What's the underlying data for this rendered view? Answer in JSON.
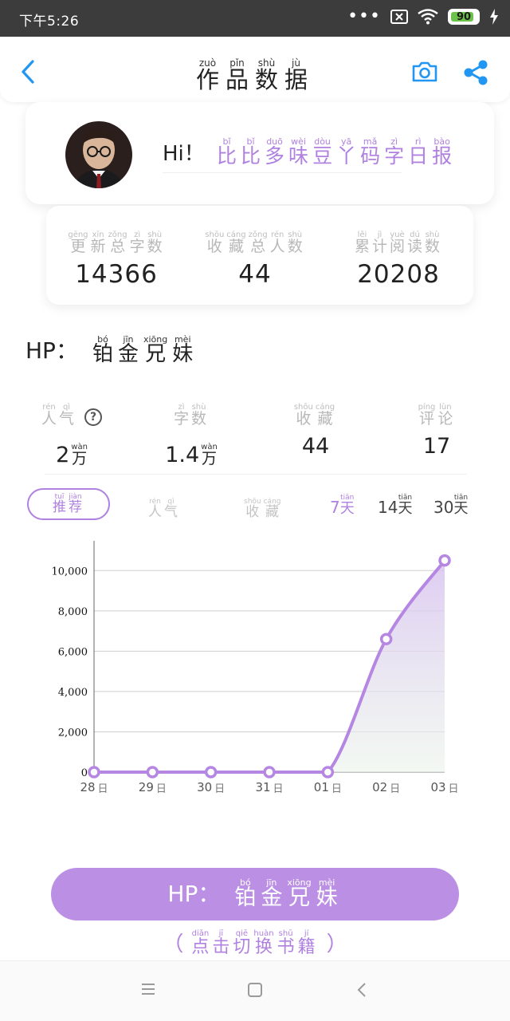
{
  "status_bar": {
    "time": "下午5:26",
    "battery": "90",
    "battery_level": 0.9
  },
  "header": {
    "title": [
      {
        "py": "zuò",
        "ch": "作"
      },
      {
        "py": "pǐn",
        "ch": "品"
      },
      {
        "py": "shù",
        "ch": "数"
      },
      {
        "py": "jù",
        "ch": "据"
      }
    ],
    "back_icon": "back-chevron-icon",
    "camera_icon": "camera-icon",
    "share_icon": "share-icon",
    "accent_color": "#2196f3"
  },
  "profile": {
    "greeting": "Hi！",
    "name": [
      {
        "py": "bǐ",
        "ch": "比"
      },
      {
        "py": "bǐ",
        "ch": "比"
      },
      {
        "py": "duō",
        "ch": "多"
      },
      {
        "py": "wèi",
        "ch": "味"
      },
      {
        "py": "dòu",
        "ch": "豆"
      },
      {
        "py": "yā",
        "ch": "丫"
      },
      {
        "py": "mǎ",
        "ch": "码"
      },
      {
        "py": "zì",
        "ch": "字"
      },
      {
        "py": "rì",
        "ch": "日"
      },
      {
        "py": "bào",
        "ch": "报"
      }
    ],
    "name_color": "#b081e0"
  },
  "stats": [
    {
      "label": [
        {
          "py": "gēng",
          "ch": "更"
        },
        {
          "py": "xīn",
          "ch": "新"
        },
        {
          "py": "zǒng",
          "ch": "总"
        },
        {
          "py": "zì",
          "ch": "字"
        },
        {
          "py": "shù",
          "ch": "数"
        }
      ],
      "value": "14366"
    },
    {
      "label": [
        {
          "py": "shōu",
          "ch": "收"
        },
        {
          "py": "cáng",
          "ch": "藏"
        },
        {
          "py": "zǒng",
          "ch": "总"
        },
        {
          "py": "rén",
          "ch": "人"
        },
        {
          "py": "shù",
          "ch": "数"
        }
      ],
      "value": "44"
    },
    {
      "label": [
        {
          "py": "lěi",
          "ch": "累"
        },
        {
          "py": "jì",
          "ch": "计"
        },
        {
          "py": "yuè",
          "ch": "阅"
        },
        {
          "py": "dú",
          "ch": "读"
        },
        {
          "py": "shù",
          "ch": "数"
        }
      ],
      "value": "20208"
    }
  ],
  "book": {
    "prefix": "HP：",
    "title": [
      {
        "py": "bó",
        "ch": "铂"
      },
      {
        "py": "jīn",
        "ch": "金"
      },
      {
        "py": "xiōng",
        "ch": "兄"
      },
      {
        "py": "mèi",
        "ch": "妹"
      }
    ]
  },
  "metrics": [
    {
      "label": [
        {
          "py": "rén",
          "ch": "人"
        },
        {
          "py": "qì",
          "ch": "气"
        }
      ],
      "value": "2",
      "unit": {
        "py": "wàn",
        "ch": "万"
      },
      "help_icon": "?"
    },
    {
      "label": [
        {
          "py": "zì",
          "ch": "字"
        },
        {
          "py": "shù",
          "ch": "数"
        }
      ],
      "value": "1.4",
      "unit": {
        "py": "wàn",
        "ch": "万"
      }
    },
    {
      "label": [
        {
          "py": "shōu",
          "ch": "收"
        },
        {
          "py": "cáng",
          "ch": "藏"
        }
      ],
      "value": "44"
    },
    {
      "label": [
        {
          "py": "píng",
          "ch": "评"
        },
        {
          "py": "lùn",
          "ch": "论"
        }
      ],
      "value": "17"
    }
  ],
  "tabs": [
    {
      "label": [
        {
          "py": "tuī",
          "ch": "推"
        },
        {
          "py": "jiàn",
          "ch": "荐"
        }
      ],
      "active": true
    },
    {
      "label": [
        {
          "py": "rén",
          "ch": "人"
        },
        {
          "py": "qì",
          "ch": "气"
        }
      ],
      "active": false
    },
    {
      "label": [
        {
          "py": "shōu",
          "ch": "收"
        },
        {
          "py": "cáng",
          "ch": "藏"
        }
      ],
      "active": false
    }
  ],
  "ranges": [
    {
      "num": "7",
      "unit": {
        "py": "tiān",
        "ch": "天"
      },
      "active": true
    },
    {
      "num": "14",
      "unit": {
        "py": "tiān",
        "ch": "天"
      },
      "active": false
    },
    {
      "num": "30",
      "unit": {
        "py": "tiān",
        "ch": "天"
      },
      "active": false
    }
  ],
  "chart_data": {
    "type": "area",
    "categories": [
      "28",
      "29",
      "30",
      "31",
      "01",
      "02",
      "03"
    ],
    "x_suffix": "日",
    "values": [
      0,
      0,
      0,
      0,
      0,
      6600,
      10500
    ],
    "y_ticks": [
      "0",
      "2,000",
      "4,000",
      "6,000",
      "8,000",
      "10,000"
    ],
    "ylim": [
      0,
      11000
    ],
    "grid": true,
    "line_color": "#b687e2",
    "fill_color": "#d8c3f0"
  },
  "main_button": {
    "prefix": "HP：",
    "title": [
      {
        "py": "bó",
        "ch": "铂"
      },
      {
        "py": "jīn",
        "ch": "金"
      },
      {
        "py": "xiōng",
        "ch": "兄"
      },
      {
        "py": "mèi",
        "ch": "妹"
      }
    ],
    "hint_open": "（",
    "hint": [
      {
        "py": "diǎn",
        "ch": "点"
      },
      {
        "py": "jī",
        "ch": "击"
      },
      {
        "py": "qiē",
        "ch": "切"
      },
      {
        "py": "huàn",
        "ch": "换"
      },
      {
        "py": "shū",
        "ch": "书"
      },
      {
        "py": "jí",
        "ch": "籍"
      }
    ],
    "hint_close": "）"
  },
  "nav_bar": {
    "menu_icon": "menu-icon",
    "home_icon": "home-square-icon",
    "back_icon": "back-triangle-icon"
  }
}
